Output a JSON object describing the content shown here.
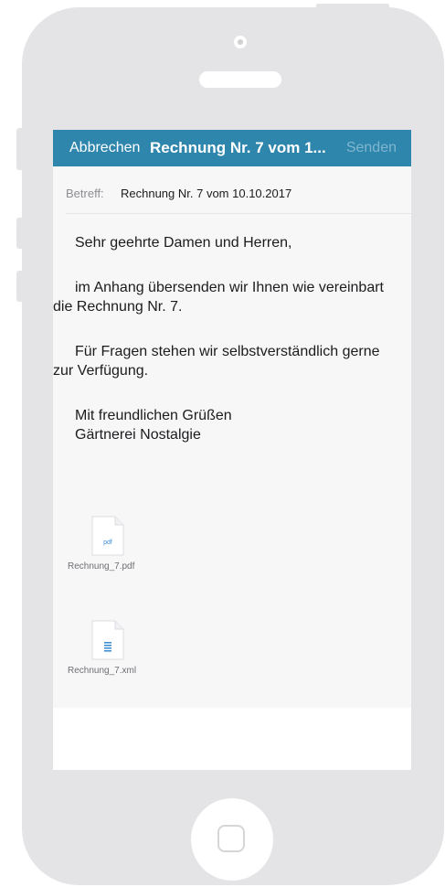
{
  "nav": {
    "cancel_label": "Abbrechen",
    "title": "Rechnung Nr. 7 vom 1...",
    "send_label": "Senden"
  },
  "subject": {
    "label": "Betreff:",
    "value": "Rechnung Nr. 7 vom 10.10.2017"
  },
  "body": {
    "greeting": "Sehr geehrte Damen und Herren,",
    "paragraph_1": "im Anhang übersenden wir Ihnen wie vereinbart die Rechnung Nr. 7.",
    "paragraph_2": "Für Fragen stehen wir selbstverständlich gerne zur Verfügung.",
    "closing": "Mit freundlichen Grüßen",
    "signature": "Gärtnerei Nostalgie"
  },
  "attachments": [
    {
      "file_name": "Rechnung_7.pdf",
      "icon_label": "pdf",
      "icon": "pdf-file-icon"
    },
    {
      "file_name": "Rechnung_7.xml",
      "icon": "document-file-icon"
    }
  ],
  "colors": {
    "nav_bar": "#2f86ad",
    "send_disabled": "#7fb6cf",
    "phone_frame": "#e4e4e6"
  }
}
